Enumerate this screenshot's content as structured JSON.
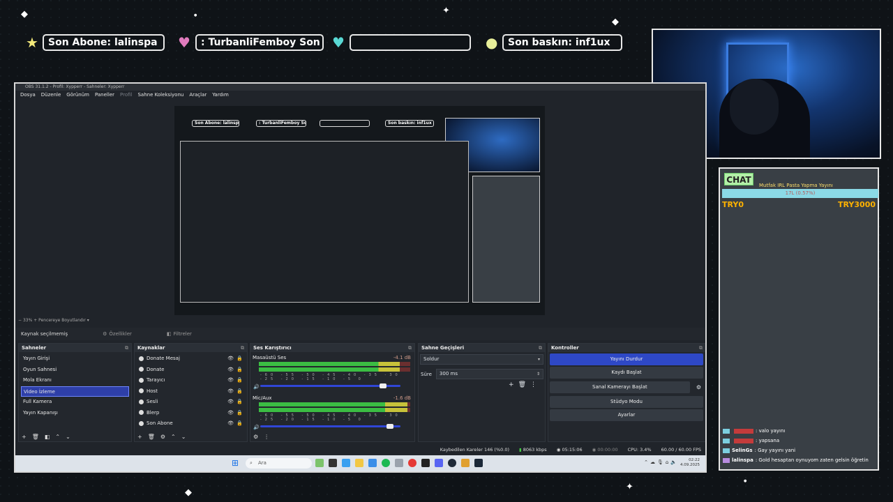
{
  "overlay": {
    "banners": {
      "last_sub": "Son Abone: lalinspa",
      "last_tip": ": TurbanliFemboy    Son Tak",
      "third": "",
      "last_raid": "Son baskın: inf1ux"
    }
  },
  "chat": {
    "label": "CHAT",
    "goal_title": "Mutfak IRL Pasta Yapma Yayını",
    "goal_progress": "17L (0.57%)",
    "goal_min": "TRY0",
    "goal_max": "TRY3000",
    "messages": [
      {
        "user": "",
        "text": ": valo yayını"
      },
      {
        "user": "",
        "text": ": yapsana"
      },
      {
        "user": "SelinGs",
        "text": ": Gay yayını yani"
      },
      {
        "user": "lalinspa",
        "text": ": Gold hesaptan oynuyom zaten gelsin öğretin"
      }
    ]
  },
  "obs": {
    "title": "OBS 31.1.2 - Profil: Xypperr - Sahneler: Xypperr",
    "menu": [
      "Dosya",
      "Düzenle",
      "Görünüm",
      "Paneller",
      "Profil",
      "Sahne Koleksiyonu",
      "Araçlar",
      "Yardım"
    ],
    "zoom": "33%",
    "zoom_mode": "Pencereye Boyutlandır",
    "source_bar": {
      "status": "Kaynak seçilmemiş",
      "properties": "Özellikler",
      "filters": "Filtreler"
    },
    "scenes": {
      "title": "Sahneler",
      "items": [
        "Yayın Girişi",
        "Oyun Sahnesi",
        "Mola Ekranı",
        "Video İzleme",
        "Full Kamera",
        "Yayın Kapanışı"
      ],
      "selected": "Video İzleme"
    },
    "sources": {
      "title": "Kaynaklar",
      "items": [
        "Donate Mesaj",
        "Donate",
        "Tarayıcı",
        "Host",
        "Sesli",
        "Blerp",
        "Son Abone"
      ]
    },
    "mixer": {
      "title": "Ses Karıştırıcı",
      "channels": [
        {
          "name": "Masaüstü Ses",
          "db": "-4.1 dB",
          "level": 0.93,
          "volume": 0.9
        },
        {
          "name": "Mic/Aux",
          "db": "-1.6 dB",
          "level": 0.98,
          "volume": 0.95
        }
      ],
      "ticks": "-60 -55 -50 -45 -40 -35 -30 -25 -20 -15 -10 -5 0"
    },
    "transitions": {
      "title": "Sahne Geçişleri",
      "type": "Soldur",
      "duration_label": "Süre",
      "duration": "300 ms"
    },
    "controls": {
      "title": "Kontroller",
      "buttons": [
        "Yayını Durdur",
        "Kaydı Başlat",
        "Sanal Kamerayı Başlat",
        "Stüdyo Modu",
        "Ayarlar"
      ]
    },
    "status": {
      "dropped": "Kaybedilen Kareler 146 (%0.0)",
      "bitrate": "8063 kbps",
      "stream_time": "05:15:06",
      "rec_time": "00:00:00",
      "cpu": "CPU: 3.4%",
      "fps": "60.00 / 60.00 FPS"
    }
  },
  "taskbar": {
    "search_placeholder": "Ara",
    "time": "02:22",
    "date": "4.09.2025"
  }
}
